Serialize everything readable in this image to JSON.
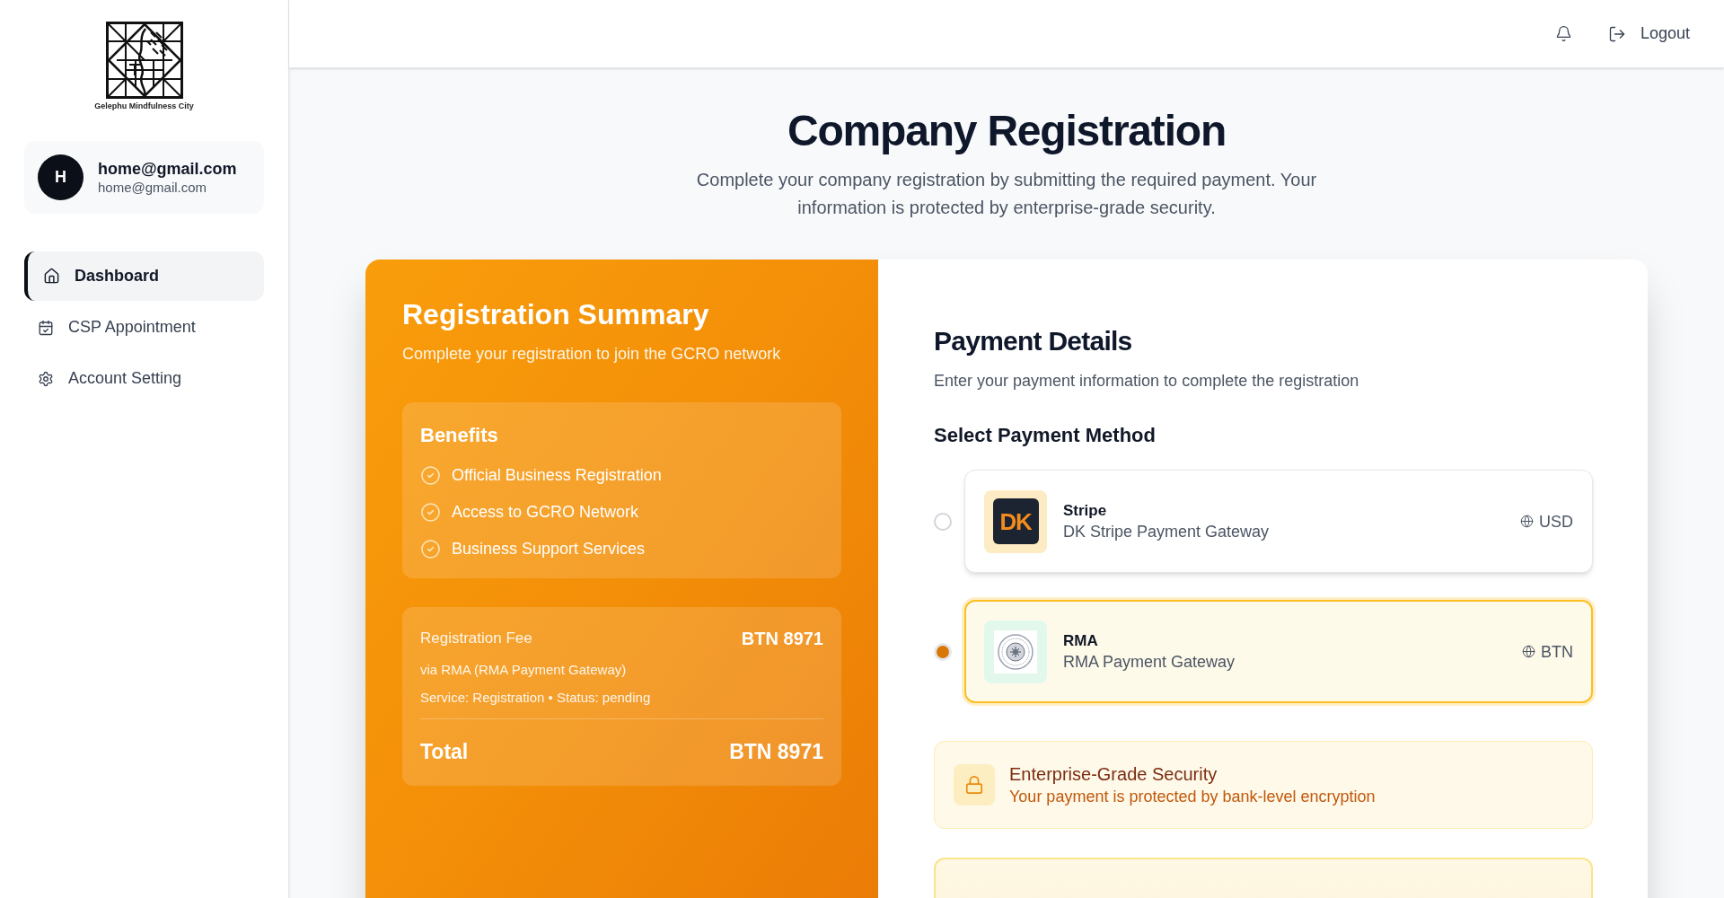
{
  "sidebar": {
    "logo": {
      "caption": "Gelephu Mindfulness City"
    },
    "user": {
      "initial": "H",
      "name": "home@gmail.com",
      "email": "home@gmail.com"
    },
    "nav": [
      {
        "label": "Dashboard",
        "selected": true
      },
      {
        "label": "CSP Appointment",
        "selected": false
      },
      {
        "label": "Account Setting",
        "selected": false
      }
    ]
  },
  "header": {
    "logout": "Logout"
  },
  "page": {
    "title": "Company Registration",
    "subtitle": "Complete your company registration by submitting the required payment. Your information is protected by enterprise-grade security."
  },
  "summary": {
    "title": "Registration Summary",
    "subtitle": "Complete your registration to join the GCRO network",
    "benefits": {
      "title": "Benefits",
      "items": [
        "Official Business Registration",
        "Access to GCRO Network",
        "Business Support Services"
      ]
    },
    "fee": {
      "label": "Registration Fee",
      "amount": "BTN 8971",
      "via": "via RMA (RMA Payment Gateway)",
      "meta": "Service: Registration • Status: pending",
      "total_label": "Total",
      "total_amount": "BTN 8971"
    }
  },
  "payment": {
    "title": "Payment Details",
    "subtitle": "Enter your payment information to complete the registration",
    "method_heading": "Select Payment Method",
    "methods": [
      {
        "kind": "stripe",
        "name": "Stripe",
        "description": "DK Stripe Payment Gateway",
        "logo_text": "DK",
        "currency": "USD",
        "selected": false
      },
      {
        "kind": "rma",
        "name": "RMA",
        "description": "RMA Payment Gateway",
        "currency": "BTN",
        "selected": true
      }
    ],
    "security": {
      "title": "Enterprise-Grade Security",
      "text": "Your payment is protected by bank-level encryption"
    }
  }
}
